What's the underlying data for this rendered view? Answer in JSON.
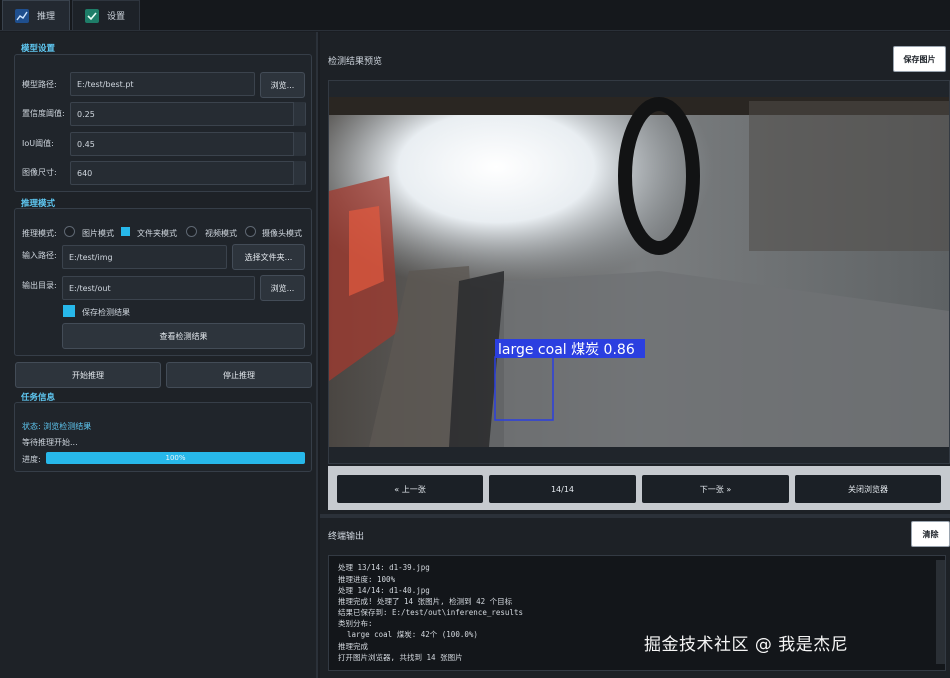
{
  "tabs": [
    {
      "label": "推理",
      "icon": "chart-icon",
      "active": true
    },
    {
      "label": "设置",
      "icon": "check-icon",
      "active": false
    }
  ],
  "model_settings": {
    "title": "模型设置",
    "model_path_label": "模型路径:",
    "model_path_value": "E:/test/best.pt",
    "browse_label": "浏览...",
    "conf_label": "置信度阈值:",
    "conf_value": "0.25",
    "iou_label": "IoU阈值:",
    "iou_value": "0.45",
    "imgsz_label": "图像尺寸:",
    "imgsz_value": "640"
  },
  "inference_mode": {
    "title": "推理模式",
    "mode_label": "推理模式:",
    "modes": [
      "图片模式",
      "文件夹模式",
      "视频模式",
      "摄像头模式"
    ],
    "selected_mode": "文件夹模式",
    "input_label": "输入路径:",
    "input_value": "E:/test/img",
    "select_folder_label": "选择文件夹...",
    "output_label": "输出目录:",
    "output_value": "E:/test/out",
    "browse_label": "浏览...",
    "save_results_label": "保存检测结果",
    "save_results_checked": true,
    "view_results_label": "查看检测结果"
  },
  "actions": {
    "start_label": "开始推理",
    "stop_label": "停止推理"
  },
  "task_info": {
    "title": "任务信息",
    "status_text": "状态: 浏览检测结果",
    "waiting_text": "等待推理开始...",
    "progress_label": "进度:",
    "progress_value": "100%",
    "progress_fraction": 1.0
  },
  "preview": {
    "title": "检测结果预览",
    "save_label": "保存图片",
    "detection_label": "large coal 煤炭 0.86",
    "prev_label": "« 上一张",
    "counter": "14/14",
    "next_label": "下一张 »",
    "close_label": "关闭浏览器"
  },
  "terminal": {
    "title": "终端输出",
    "clear_label": "清除",
    "lines": [
      "处理 13/14: d1-39.jpg",
      "推理进度: 100%",
      "处理 14/14: d1-40.jpg",
      "推理完成! 处理了 14 张图片, 检测到 42 个目标",
      "结果已保存到: E:/test/out\\inference_results",
      "类别分布:",
      "  large coal 煤炭: 42个 (100.0%)",
      "推理完成",
      "打开图片浏览器, 共找到 14 张图片"
    ]
  },
  "watermark": "掘金技术社区 @ 我是杰尼",
  "colors": {
    "accent": "#27b8ea",
    "section_title": "#5fc8f2",
    "detection_box": "#2b3fe0"
  }
}
